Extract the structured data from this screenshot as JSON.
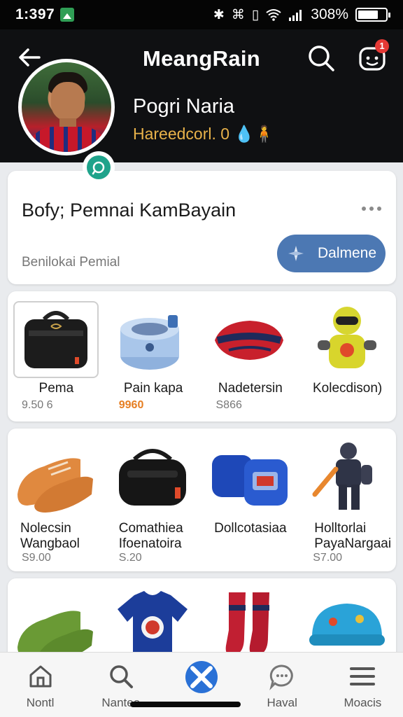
{
  "status_bar": {
    "time": "1:397",
    "battery_text": "308%",
    "battery_level": 0.75,
    "icons": [
      "bluetooth-icon",
      "vibrate-icon",
      "nfc-icon",
      "wifi-icon",
      "signal-icon"
    ]
  },
  "header": {
    "title": "MeangRain",
    "chat_badge": "1"
  },
  "profile": {
    "name": "Pogri Naria",
    "subtitle": "Hareedcorl. 0",
    "emoji": "💧🧍"
  },
  "promo": {
    "title": "Bofy; Pemnai KamBayain",
    "subtitle": "Benilokai Pemial",
    "button_label": "Dalmene"
  },
  "products": [
    {
      "name": "Pema",
      "price": "9.50 6",
      "icon": "black-bag-icon"
    },
    {
      "name": "Pain kapa",
      "price": "9960",
      "icon": "blue-pot-icon",
      "accent": true
    },
    {
      "name": "Nadetersin",
      "price": "S866",
      "icon": "red-pouch-icon"
    },
    {
      "name": "Kolecdison)",
      "price": "",
      "icon": "yellow-figure-icon"
    },
    {
      "name": "Nolecsin Wangbaol",
      "price": "S9.00",
      "icon": "orange-shoes-icon"
    },
    {
      "name": "Comathiea Ifoenatoira",
      "price": "S.20",
      "icon": "black-duffel-icon"
    },
    {
      "name": "Dollcotasiaa",
      "price": "",
      "icon": "blue-bags-icon"
    },
    {
      "name": "Holltorlai PayaNargaai",
      "price": "S7.00",
      "icon": "robot-figure-icon"
    },
    {
      "name": "",
      "price": "",
      "icon": "green-shoes-icon"
    },
    {
      "name": "",
      "price": "",
      "icon": "blue-jersey-icon"
    },
    {
      "name": "",
      "price": "",
      "icon": "red-socks-icon"
    },
    {
      "name": "",
      "price": "",
      "icon": "blue-cap-icon"
    }
  ],
  "bottom_nav": [
    {
      "label": "Nontl",
      "icon": "home-icon"
    },
    {
      "label": "Nanteo",
      "icon": "search-icon"
    },
    {
      "label": "",
      "icon": "close-icon"
    },
    {
      "label": "Haval",
      "icon": "chat-bubble-icon"
    },
    {
      "label": "Moacis",
      "icon": "menu-icon"
    }
  ],
  "colors": {
    "header_bg": "#0f1012",
    "accent_blue": "#2a71d6",
    "pill_blue": "#4c78b3",
    "price_accent": "#e67e22",
    "badge_red": "#e53935"
  }
}
